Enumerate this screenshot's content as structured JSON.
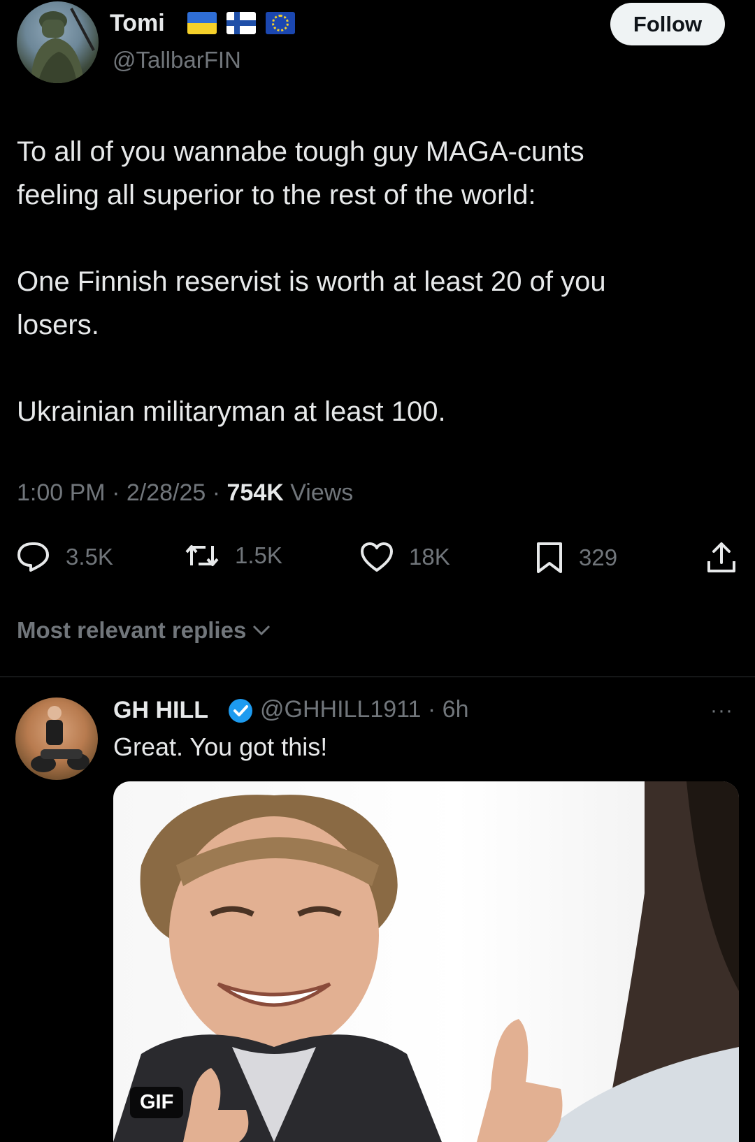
{
  "tweet": {
    "author": {
      "display_name": "Tomi",
      "handle": "@TallbarFIN",
      "flags": [
        "ukraine-flag",
        "finland-flag",
        "eu-flag"
      ]
    },
    "follow_label": "Follow",
    "text_lines": [
      "To all of you wannabe tough guy MAGA-cunts",
      "feeling all superior to the rest of the world:",
      "One Finnish reservist is worth at least 20 of you",
      "losers.",
      "Ukrainian militaryman at least 100."
    ],
    "meta": {
      "time_date": "1:00 PM · 2/28/25 · ",
      "views_count": "754K",
      "views_label": " Views"
    },
    "actions": {
      "replies": "3.5K",
      "reposts": "1.5K",
      "likes": "18K",
      "bookmarks": "329"
    }
  },
  "replies_sort_label": "Most relevant replies",
  "reply": {
    "display_name": "GH HILL",
    "handle_time": "@GHHILL1911 · 6h",
    "more_label": "···",
    "text": "Great. You got this!",
    "media_badge": "GIF"
  },
  "colors": {
    "background": "#000000",
    "primary_text": "#e7e9ea",
    "secondary_text": "#71767b",
    "verified": "#1d9bf0",
    "divider": "#2f3336"
  }
}
